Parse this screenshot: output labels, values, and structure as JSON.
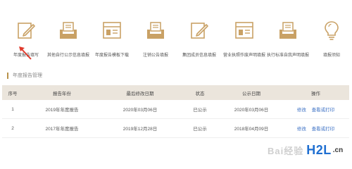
{
  "toolbar": {
    "items": [
      {
        "label": "年度报告填写",
        "icon": "edit-icon"
      },
      {
        "label": "其他自行公示信息填报",
        "icon": "document-tray-icon"
      },
      {
        "label": "年度报告模板下载",
        "icon": "template-download-icon"
      },
      {
        "label": "注销公告填报",
        "icon": "cancellation-tray-icon"
      },
      {
        "label": "集团成员信息填报",
        "icon": "edit-icon"
      },
      {
        "label": "营业执照作废声明填报",
        "icon": "license-void-icon"
      },
      {
        "label": "执行标准自我声明填报",
        "icon": "standard-statement-icon"
      },
      {
        "label": "填报须知",
        "icon": "lightbulb-icon"
      }
    ]
  },
  "section": {
    "title": "年度报告管理"
  },
  "table": {
    "headers": [
      "序号",
      "报告年份",
      "最后修改日期",
      "状态",
      "公示日期",
      "操作"
    ],
    "rows": [
      {
        "index": "1",
        "year": "2019年年度报告",
        "modified": "2020年03月06日",
        "status": "已公示",
        "published": "2020年03月06日",
        "action_edit": "修改",
        "action_view": "查看或打印"
      },
      {
        "index": "2",
        "year": "2017年年度报告",
        "modified": "2019年12月28日",
        "status": "已公示",
        "published": "2018年04月09日",
        "action_edit": "修改",
        "action_view": "查看或打印"
      }
    ]
  },
  "watermark": {
    "baidu": "Bai经验",
    "brand": "H2L",
    "cn": ".cn"
  },
  "colors": {
    "accent": "#c9a165",
    "header_bg": "#ebe5dc",
    "link": "#3a6fc4",
    "arrow": "#e03a2c"
  }
}
